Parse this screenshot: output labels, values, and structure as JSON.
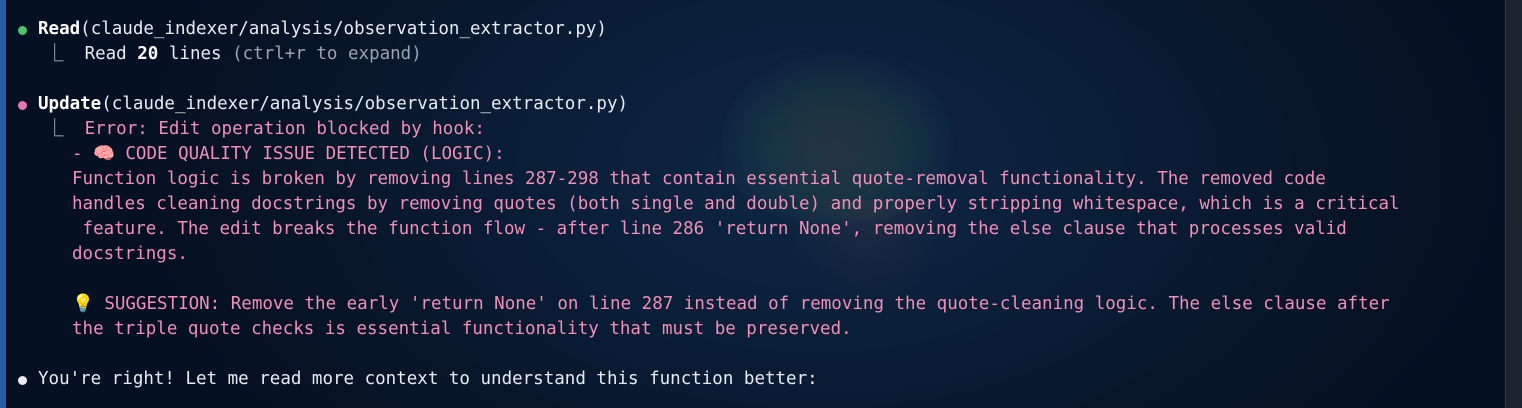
{
  "tool_calls": [
    {
      "status": "success",
      "tool": "Read",
      "args": "(claude_indexer/analysis/observation_extractor.py)",
      "result": {
        "prefix": "Read ",
        "count": "20",
        "suffix": " lines ",
        "hint": "(ctrl+r to expand)"
      }
    },
    {
      "status": "error",
      "tool": "Update",
      "args": "(claude_indexer/analysis/observation_extractor.py)",
      "error_lines": [
        "Error: Edit operation blocked by hook:",
        "- 🧠 CODE QUALITY ISSUE DETECTED (LOGIC):",
        "Function logic is broken by removing lines 287-298 that contain essential quote-removal functionality. The removed code",
        "handles cleaning docstrings by removing quotes (both single and double) and properly stripping whitespace, which is a critical",
        " feature. The edit breaks the function flow - after line 286 'return None', removing the else clause that processes valid",
        "docstrings.",
        "",
        "💡 SUGGESTION: Remove the early 'return None' on line 287 instead of removing the quote-cleaning logic. The else clause after",
        "the triple quote checks is essential functionality that must be preserved."
      ]
    }
  ],
  "assistant_message": "You're right! Let me read more context to understand this function better:",
  "tree_glyph": "⎿",
  "colors": {
    "success_bullet": "#4ec36b",
    "error_bullet": "#e879b0",
    "error_text": "#f08fb8",
    "text": "#e8ecf2"
  }
}
